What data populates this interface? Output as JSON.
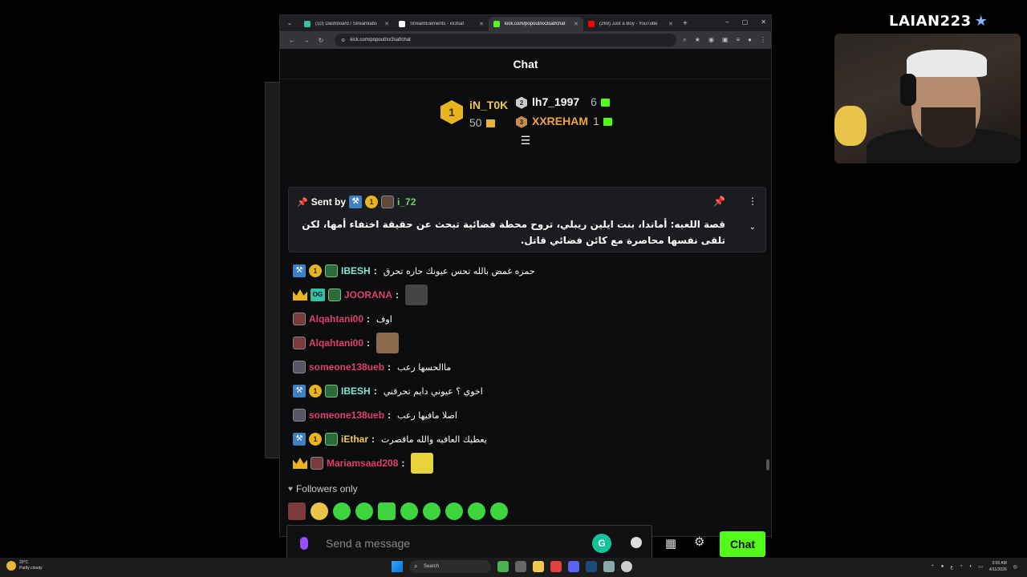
{
  "streamer": {
    "name": "LAIAN223",
    "star_icon": "star-icon"
  },
  "browser": {
    "tabs": [
      {
        "title": "(10) Dashboard / Streamlabs",
        "color": "#31c3a2",
        "active": false
      },
      {
        "title": "StreamElements - xx3saf",
        "color": "#ffffff",
        "active": false
      },
      {
        "title": "kick.com/popout/xx3saf/chat",
        "color": "#53fc18",
        "active": true
      },
      {
        "title": "(269) Just a Boy - YouTube",
        "color": "#ff0000",
        "active": false
      }
    ],
    "url": "kick.com/popout/xx3saf/chat"
  },
  "chat": {
    "title": "Chat",
    "leaderboard": {
      "first": {
        "rank": "1",
        "name": "iN_T0K",
        "count": "50"
      },
      "second": {
        "rank": "2",
        "name": "lh7_1997",
        "count": "6"
      },
      "third": {
        "rank": "3",
        "name": "XXREHAM",
        "count": "1"
      }
    },
    "pinned": {
      "sent_by_label": "Sent by",
      "badge_number": "1",
      "user": "i_72",
      "text": "قصة اللعبه: أماندا، بنت ايلين ريبلي، تروح محطة فضائية تبحث عن حقيقة اختفاء أمها، لكن تلقى نفسها محاصرة مع كائن فضائي قاتل."
    },
    "messages": [
      {
        "badges": [
          "hammer",
          "gold",
          "sub"
        ],
        "badge_number": "1",
        "user": "IBESH",
        "color": "#7fe8d0",
        "text": "حمزه غمض بالله تحس عيونك حاره تحرق",
        "emote": null
      },
      {
        "badges": [
          "crown",
          "og",
          "sub"
        ],
        "badge_number": "",
        "user": "JOORANA",
        "color": "#e0406a",
        "text": "",
        "emote": "#444444"
      },
      {
        "badges": [
          "avatar"
        ],
        "badge_number": "",
        "user": "Alqahtani00",
        "color": "#e0406a",
        "text": "اوف",
        "emote": null
      },
      {
        "badges": [
          "avatar"
        ],
        "badge_number": "",
        "user": "Alqahtani00",
        "color": "#e0406a",
        "text": "",
        "emote": "#8a6a4a"
      },
      {
        "badges": [
          "avatar2"
        ],
        "badge_number": "",
        "user": "someone138ueb",
        "color": "#e0406a",
        "text": "ماالحسها رعب",
        "emote": null
      },
      {
        "badges": [
          "hammer",
          "gold",
          "sub"
        ],
        "badge_number": "1",
        "user": "IBESH",
        "color": "#7fe8d0",
        "text": "اخوي ؟ عيوني دايم تحرقني",
        "emote": null
      },
      {
        "badges": [
          "avatar2"
        ],
        "badge_number": "",
        "user": "someone138ueb",
        "color": "#e0406a",
        "text": "اصلا مافيها رعب",
        "emote": null
      },
      {
        "badges": [
          "hammer",
          "gold",
          "sub"
        ],
        "badge_number": "1",
        "user": "iEthar",
        "color": "#f2c94c",
        "text": "يعطيك العافيه والله ماقصرت",
        "emote": null
      },
      {
        "badges": [
          "crown",
          "avatar"
        ],
        "badge_number": "",
        "user": "Mariamsaad208",
        "color": "#e0406a",
        "text": "",
        "emote": "#e8d43a"
      }
    ],
    "followers_only": "Followers only",
    "input_placeholder": "Send a message",
    "chat_button": "Chat"
  },
  "taskbar": {
    "weather_temp": "20°C",
    "weather_desc": "Partly cloudy",
    "search_label": "Search",
    "time": "3:06 AM",
    "date": "4/11/2026"
  },
  "colors": {
    "kick_green": "#53fc18",
    "gold": "#e9b41e"
  }
}
